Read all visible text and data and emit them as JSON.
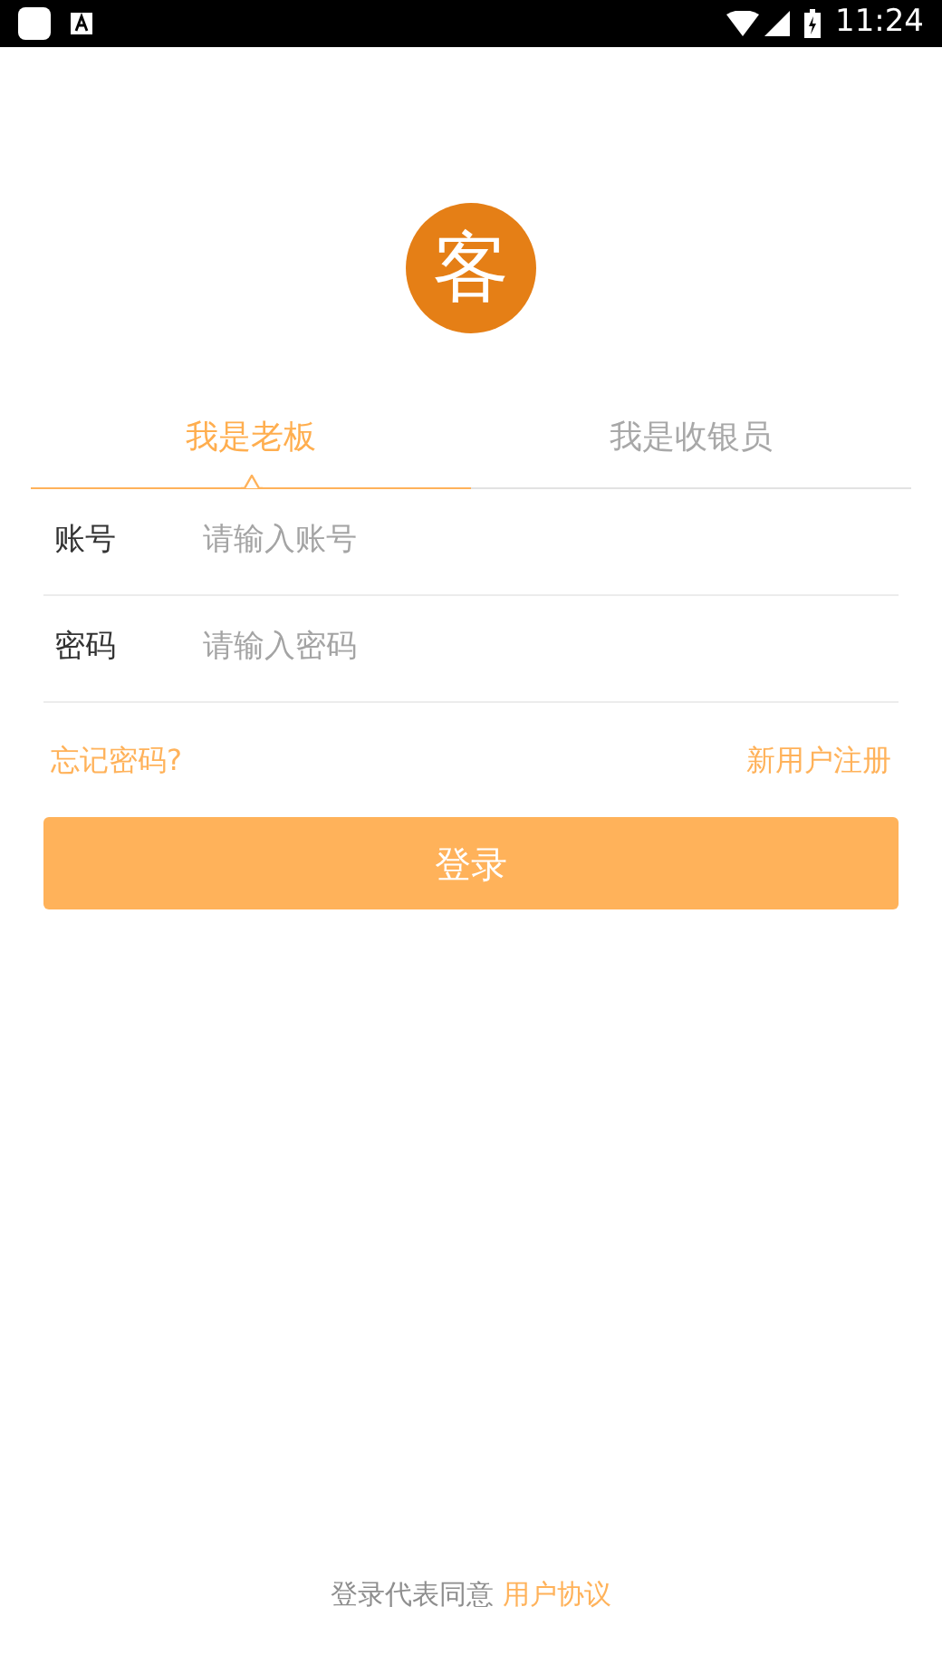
{
  "status_bar": {
    "time": "11:24"
  },
  "logo": {
    "text": "客"
  },
  "tabs": [
    {
      "label": "我是老板",
      "selected": true
    },
    {
      "label": "我是收银员",
      "selected": false
    }
  ],
  "fields": [
    {
      "label": "账号",
      "placeholder": "请输入账号"
    },
    {
      "label": "密码",
      "placeholder": "请输入密码"
    }
  ],
  "links": {
    "forgot": "忘记密码?",
    "register": "新用户注册"
  },
  "login_button": "登录",
  "footer": {
    "text": "登录代表同意",
    "link": "用户协议"
  }
}
